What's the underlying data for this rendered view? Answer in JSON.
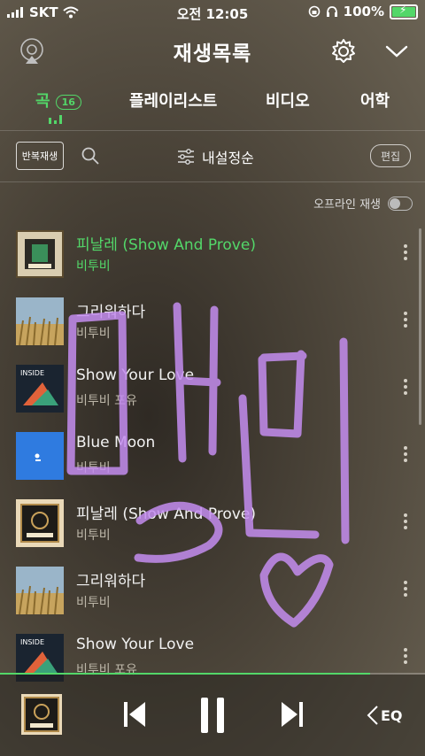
{
  "status_bar": {
    "carrier": "SKT",
    "time": "오전 12:05",
    "battery": "100%"
  },
  "header": {
    "title": "재생목록"
  },
  "tabs": [
    {
      "label": "곡",
      "count": "16",
      "active": true
    },
    {
      "label": "플레이리스트"
    },
    {
      "label": "비디오"
    },
    {
      "label": "어학"
    }
  ],
  "toolbar": {
    "repeat_label": "반복재생",
    "sort_label": "내설정순",
    "edit_label": "편집"
  },
  "offline": {
    "label": "오프라인 재생",
    "enabled": false
  },
  "songs": [
    {
      "title": "피날레 (Show And Prove)",
      "artist": "비투비",
      "playing": true
    },
    {
      "title": "그리워하다",
      "artist": "비투비"
    },
    {
      "title": "Show Your Love",
      "artist": "비투비 포유"
    },
    {
      "title": "Blue Moon",
      "artist": "비투비"
    },
    {
      "title": "피날레 (Show And Prove)",
      "artist": "비투비"
    },
    {
      "title": "그리워하다",
      "artist": "비투비"
    },
    {
      "title": "Show Your Love",
      "artist": "비투비 포유"
    }
  ],
  "player": {
    "progress": 0.87,
    "eq_label": "EQ"
  },
  "colors": {
    "accent": "#53d769",
    "doodle": "#c48df0"
  },
  "icons": [
    "wifi-icon",
    "airplay-icon",
    "gear-icon",
    "chevron-down-icon",
    "search-icon",
    "sliders-icon",
    "previous-icon",
    "pause-icon",
    "next-icon",
    "eq-icon"
  ]
}
